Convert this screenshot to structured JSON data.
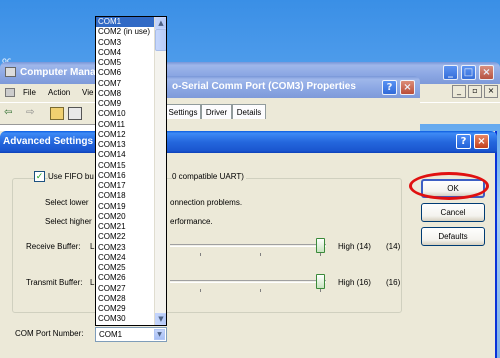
{
  "desktop": {
    "label": "oc"
  },
  "computer_management": {
    "title": "Computer Mana",
    "menu": [
      "File",
      "Action",
      "Vie"
    ]
  },
  "port_properties": {
    "title": "o-Serial Comm Port (COM3) Properties",
    "tabs": [
      "Settings",
      "Driver",
      "Details"
    ]
  },
  "advanced": {
    "title": "Advanced Settings f",
    "fifo_label_left": "Use FIFO bu",
    "fifo_label_right": "0 compatible UART)",
    "hint1_left": "Select lower",
    "hint1_right": "onnection problems.",
    "hint2_left": "Select higher",
    "hint2_right": "erformance.",
    "receive_label": "Receive Buffer:",
    "receive_low": "L",
    "receive_high": "High (14)",
    "receive_value": "(14)",
    "receive_level": 1.0,
    "transmit_label": "Transmit Buffer:",
    "transmit_low": "L",
    "transmit_high": "High (16)",
    "transmit_value": "(16)",
    "transmit_level": 1.0,
    "com_port_label": "COM Port Number:",
    "com_port_value": "COM1",
    "buttons": {
      "ok": "OK",
      "cancel": "Cancel",
      "defaults": "Defaults"
    },
    "help": "?",
    "close": "×"
  },
  "com_list": [
    "COM1",
    "COM2 (in use)",
    "COM3",
    "COM4",
    "COM5",
    "COM6",
    "COM7",
    "COM8",
    "COM9",
    "COM10",
    "COM11",
    "COM12",
    "COM13",
    "COM14",
    "COM15",
    "COM16",
    "COM17",
    "COM18",
    "COM19",
    "COM20",
    "COM21",
    "COM22",
    "COM23",
    "COM24",
    "COM25",
    "COM26",
    "COM27",
    "COM28",
    "COM29",
    "COM30"
  ],
  "highlight_color": "#e01010",
  "selection_color": "#316ac5"
}
